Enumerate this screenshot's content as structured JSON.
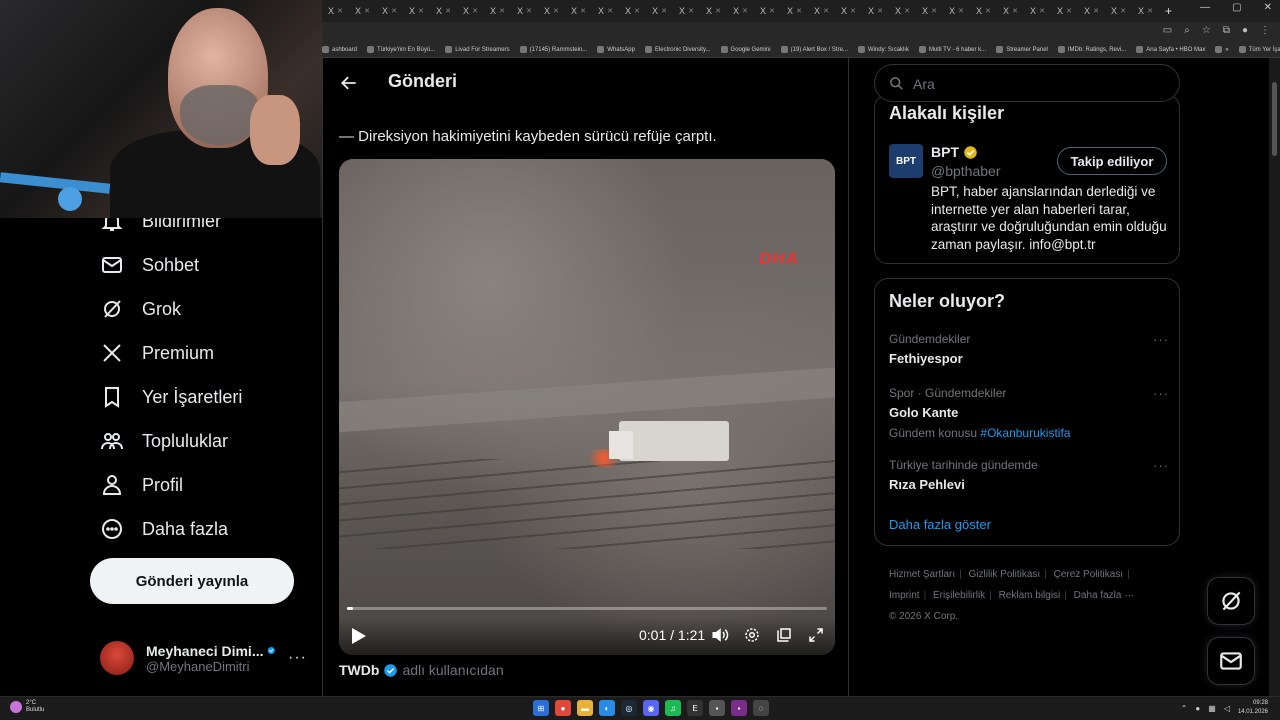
{
  "browser": {
    "tab_labels": [
      "X",
      "X",
      "X",
      "X",
      "X",
      "X",
      "X",
      "X",
      "X",
      "X",
      "X",
      "X",
      "X",
      "X",
      "X",
      "X",
      "X",
      "X",
      "X",
      "X",
      "X",
      "X",
      "X",
      "X",
      "X",
      "X",
      "X",
      "X",
      "X",
      "X",
      "X"
    ],
    "bookmarks": [
      "ashboard",
      "Türkiye'nin En Büyü...",
      "Livad For Streamers",
      "(17145) Rammstein...",
      "WhatsApp",
      "Electronic Diversity...",
      "Google Gemini",
      "(19) Alert Box / Stre...",
      "Windy: Sıcaklık",
      "Multi TV - 6 haber k...",
      "Streamer Panel",
      "IMDb: Ratings, Revi...",
      "Ana Sayfa • HBO Max",
      "»",
      "Tüm Yer İşaretleri"
    ]
  },
  "nav": {
    "items": [
      {
        "label": "Bildirimler",
        "icon": "bell-icon"
      },
      {
        "label": "Sohbet",
        "icon": "mail-icon"
      },
      {
        "label": "Grok",
        "icon": "grok-icon"
      },
      {
        "label": "Premium",
        "icon": "x-logo-icon"
      },
      {
        "label": "Yer İşaretleri",
        "icon": "bookmark-icon"
      },
      {
        "label": "Topluluklar",
        "icon": "communities-icon"
      },
      {
        "label": "Profil",
        "icon": "person-icon"
      },
      {
        "label": "Daha fazla",
        "icon": "more-circle-icon"
      }
    ],
    "post_button": "Gönderi yayınla",
    "account": {
      "name": "Meyhaneci Dimi...",
      "handle": "@MeyhaneDimitri"
    }
  },
  "main": {
    "title": "Gönderi",
    "tweet_text": "— Direksiyon hakimiyetini kaybeden sürücü refüje çarptı.",
    "video": {
      "watermark": "DHA",
      "time": "0:01 / 1:21",
      "progress": 0.013
    },
    "source_name": "TWDb",
    "source_suffix": "adlı kullanıcıdan"
  },
  "right": {
    "search_placeholder": "Ara",
    "related_title": "Alakalı kişiler",
    "related_account": {
      "name": "BPT",
      "handle": "@bpthaber",
      "logo": "BPT",
      "follow_label": "Takip ediliyor",
      "bio": "BPT, haber ajanslarından derlediği ve internette yer alan haberleri tarar, araştırır ve doğruluğundan emin olduğu zaman paylaşır. info@bpt.tr"
    },
    "trends_title": "Neler oluyor?",
    "trends": [
      {
        "category": "Gündemdekiler",
        "name": "Fethiyespor",
        "extra_label": "",
        "extra_tag": ""
      },
      {
        "category": "Spor · Gündemdekiler",
        "name": "Golo Kante",
        "extra_label": "Gündem konusu",
        "extra_tag": "#Okanburukistifa"
      },
      {
        "category": "Türkiye tarihinde gündemde",
        "name": "Rıza Pehlevi",
        "extra_label": "",
        "extra_tag": ""
      }
    ],
    "show_more": "Daha fazla göster",
    "footer": {
      "terms": "Hizmet Şartları",
      "privacy": "Gizlilik Politikası",
      "cookies": "Çerez Politikası",
      "imprint": "Imprint",
      "accessibility": "Erişilebilirlik",
      "ads": "Reklam bilgisi",
      "more": "Daha fazla ···",
      "copyright": "© 2026 X Corp."
    }
  },
  "taskbar": {
    "weather_temp": "2°C",
    "weather_desc": "Bulutlu",
    "time": "09:28",
    "date": "14.01.2026"
  }
}
